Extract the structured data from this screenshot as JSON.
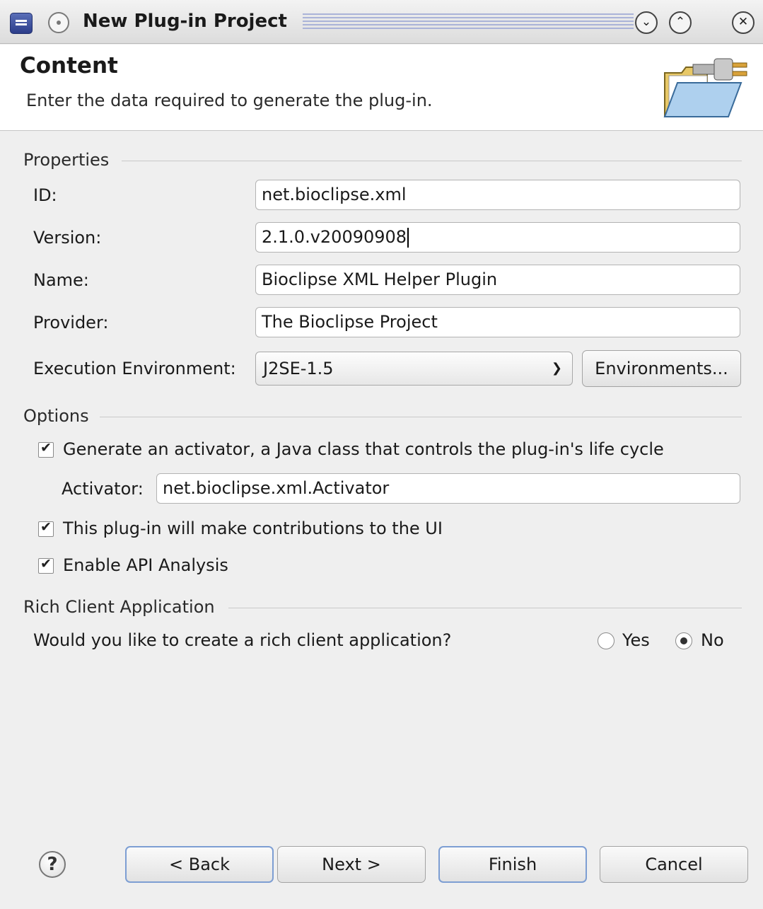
{
  "window": {
    "title": "New Plug-in Project",
    "controls": {
      "minimize": "⌄",
      "maximize": "⌃",
      "close": "✕"
    }
  },
  "header": {
    "title": "Content",
    "description": "Enter the data required to generate the plug-in."
  },
  "properties": {
    "group_label": "Properties",
    "id": {
      "label": "ID:",
      "value": "net.bioclipse.xml"
    },
    "version": {
      "label": "Version:",
      "value": "2.1.0.v20090908"
    },
    "name": {
      "label": "Name:",
      "value": "Bioclipse XML Helper Plugin"
    },
    "provider": {
      "label": "Provider:",
      "value": "The Bioclipse Project"
    },
    "execution_environment": {
      "label": "Execution Environment:",
      "value": "J2SE-1.5",
      "button": "Environments..."
    }
  },
  "options": {
    "group_label": "Options",
    "generate_activator": {
      "label": "Generate an activator, a Java class that controls the plug-in's life cycle",
      "checked": true
    },
    "activator": {
      "label": "Activator:",
      "value": "net.bioclipse.xml.Activator"
    },
    "ui_contributions": {
      "label": "This plug-in will make contributions to the UI",
      "checked": true
    },
    "api_analysis": {
      "label": "Enable API Analysis",
      "checked": true
    }
  },
  "rca": {
    "group_label": "Rich Client Application",
    "question": "Would you like to create a rich client application?",
    "yes": {
      "label": "Yes",
      "selected": false
    },
    "no": {
      "label": "No",
      "selected": true
    }
  },
  "footer": {
    "help": "?",
    "back": "< Back",
    "next": "Next >",
    "finish": "Finish",
    "cancel": "Cancel"
  },
  "icons": [
    "app-icon",
    "window-menu-icon",
    "minimize-icon",
    "maximize-icon",
    "close-icon",
    "folder-plug-icon",
    "chevron-down-icon",
    "check-icon",
    "help-icon"
  ]
}
